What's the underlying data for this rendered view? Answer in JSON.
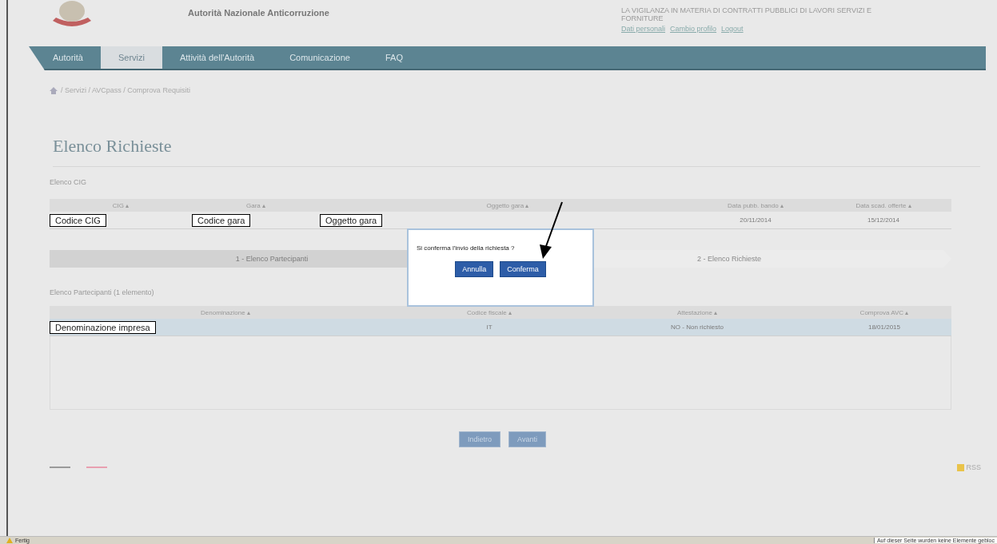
{
  "header": {
    "title": "Autorità Nazionale Anticorruzione",
    "right_text": "LA VIGILANZA IN MATERIA DI CONTRATTI PUBBLICI DI LAVORI SERVIZI E FORNITURE",
    "user_links": [
      "Dati personali",
      "Cambio profilo",
      "Logout"
    ]
  },
  "nav": [
    {
      "label": "Autorità",
      "selected": false
    },
    {
      "label": "Servizi",
      "selected": true
    },
    {
      "label": "Attività dell'Autorità",
      "selected": false
    },
    {
      "label": "Comunicazione",
      "selected": false
    },
    {
      "label": "FAQ",
      "selected": false
    }
  ],
  "breadcrumb": "/ Servizi / AVCpass / Comprova Requisiti",
  "page_title": "Elenco Richieste",
  "cig_table": {
    "caption": "Elenco CIG",
    "columns": [
      "CIG ▴",
      "Gara ▴",
      "Oggetto gara ▴",
      "Data pubb. bando ▴",
      "Data scad. offerte ▴"
    ],
    "rows": [
      {
        "cells": [
          {
            "kind": "annotation",
            "text": "Codice CIG"
          },
          {
            "kind": "annotation",
            "text": "Codice gara"
          },
          {
            "kind": "annotation",
            "text": "Oggetto gara"
          },
          {
            "kind": "plain",
            "text": "20/11/2014"
          },
          {
            "kind": "plain",
            "text": "15/12/2014"
          }
        ]
      }
    ]
  },
  "steps": [
    {
      "label": "1 - Elenco Partecipanti",
      "selected": true
    },
    {
      "label": "2 - Elenco Richieste",
      "selected": false
    }
  ],
  "participants": {
    "caption": "Elenco Partecipanti (1 elemento)",
    "columns": [
      "Denominazione ▴",
      "Codice fiscale ▴",
      "Attestazione ▴",
      "Comprova AVC ▴"
    ],
    "rows": [
      {
        "selected": true,
        "cells": [
          {
            "kind": "annotation",
            "text": "Denominazione impresa"
          },
          {
            "kind": "plain",
            "text": "IT"
          },
          {
            "kind": "plain",
            "text": "NO - Non richiesto"
          },
          {
            "kind": "plain",
            "text": "18/01/2015"
          }
        ]
      }
    ]
  },
  "dialog": {
    "message": "Si conferma l'invio della richiesta ?",
    "buttons": [
      "Annulla",
      "Conferma"
    ]
  },
  "actions": [
    "Indietro",
    "Avanti"
  ],
  "footer": {
    "rss": "RSS"
  },
  "status_bar": {
    "left": "Fertig",
    "right": "Auf dieser Seite wurden keine Elemente gebloc"
  }
}
